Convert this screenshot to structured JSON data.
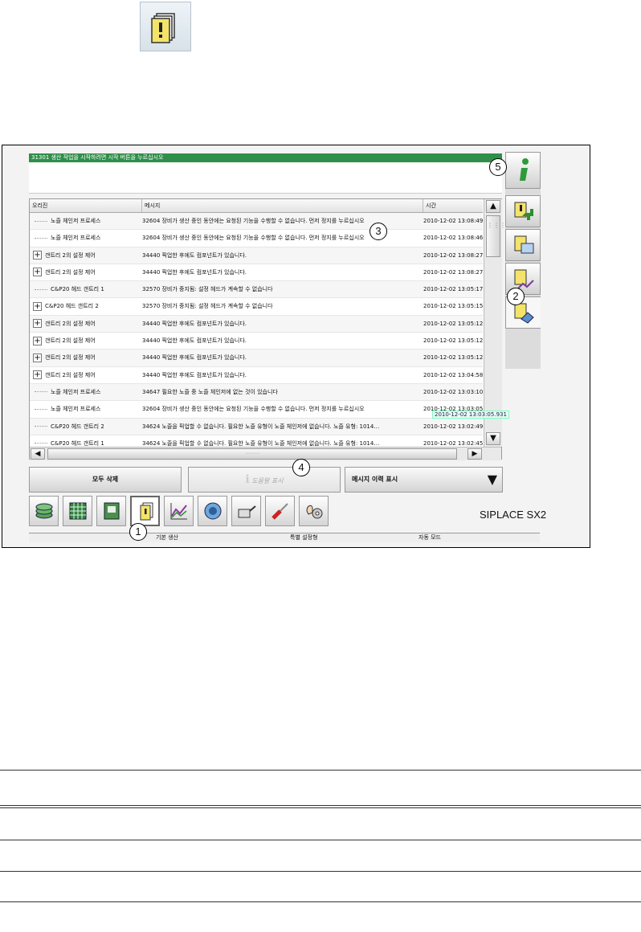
{
  "message_bar": "31301 생산 작업을 시작하려면 시작 버튼을 누르십시오",
  "columns": [
    "오리진",
    "메시지",
    "시간"
  ],
  "rows": [
    {
      "expand": false,
      "origin": "노즐 체인저 프로세스",
      "message": "32604 장비가 생산 중인 동안에는 요청된 기능을 수행할 수 없습니다. 먼저 정지를 누르십시오",
      "time": "2010-12-02 13:08:49"
    },
    {
      "expand": false,
      "origin": "노즐 체인저 프로세스",
      "message": "32604 장비가 생산 중인 동안에는 요청된 기능을 수행할 수 없습니다. 먼저 정지를 누르십시오",
      "time": "2010-12-02 13:08:46"
    },
    {
      "expand": true,
      "origin": "갠트리 2의 설정 제어",
      "message": "34440 픽업한 후에도 컴포넌트가 있습니다.",
      "time": "2010-12-02 13:08:27"
    },
    {
      "expand": true,
      "origin": "갠트리 2의 설정 제어",
      "message": "34440 픽업한 후에도 컴포넌트가 있습니다.",
      "time": "2010-12-02 13:08:27"
    },
    {
      "expand": false,
      "origin": "C&P20 헤드 갠트리 1",
      "message": "32570 장비가 중지됨: 설정 헤드가 계속할 수 없습니다",
      "time": "2010-12-02 13:05:17"
    },
    {
      "expand": true,
      "origin": "C&P20 헤드 갠트리 2",
      "message": "32570 장비가 중지됨: 설정 헤드가 계속할 수 없습니다",
      "time": "2010-12-02 13:05:15"
    },
    {
      "expand": true,
      "origin": "갠트리 2의 설정 제어",
      "message": "34440 픽업한 후에도 컴포넌트가 있습니다.",
      "time": "2010-12-02 13:05:12"
    },
    {
      "expand": true,
      "origin": "갠트리 2의 설정 제어",
      "message": "34440 픽업한 후에도 컴포넌트가 있습니다.",
      "time": "2010-12-02 13:05:12"
    },
    {
      "expand": true,
      "origin": "갠트리 2의 설정 제어",
      "message": "34440 픽업한 후에도 컴포넌트가 있습니다.",
      "time": "2010-12-02 13:05:12"
    },
    {
      "expand": true,
      "origin": "갠트리 2의 설정 제어",
      "message": "34440 픽업한 후에도 컴포넌트가 있습니다.",
      "time": "2010-12-02 13:04:58"
    },
    {
      "expand": false,
      "origin": "노즐 체인저 프로세스",
      "message": "34647 필요한 노즐 중 노즐 체인저에 없는 것이 있습니다",
      "time": "2010-12-02 13:03:10"
    },
    {
      "expand": false,
      "origin": "노즐 체인저 프로세스",
      "message": "32604 장비가 생산 중인 동안에는 요청된 기능을 수행할 수 없습니다. 먼저 정지를 누르십시오",
      "time": "2010-12-02 13:03:05"
    },
    {
      "expand": false,
      "origin": "C&P20 헤드 갠트리 2",
      "message": "34624 노즐을 픽업할 수 없습니다. 필요한 노즐 유형이 노즐 체인저에 없습니다. 노즐 유형: 1014…",
      "time": "2010-12-02 13:02:49"
    },
    {
      "expand": false,
      "origin": "C&P20 헤드 갠트리 1",
      "message": "34624 노즐을 픽업할 수 없습니다. 필요한 노즐 유형이 노즐 체인저에 없습니다. 노즐 유형: 1014…",
      "time": "2010-12-02 13:02:45"
    }
  ],
  "tooltip": "2010-12-02 13:03:05.931",
  "actions": {
    "delete_all": "모두 삭제",
    "show_help": "도움말 표시",
    "history": "메시지 이력 표시"
  },
  "brand": "SIPLACE SX2",
  "status": {
    "mode1": "기본 생산",
    "mode2": "특별 설정형",
    "mode3": "자동 모드"
  },
  "callouts": [
    "1",
    "2",
    "3",
    "4",
    "5"
  ]
}
